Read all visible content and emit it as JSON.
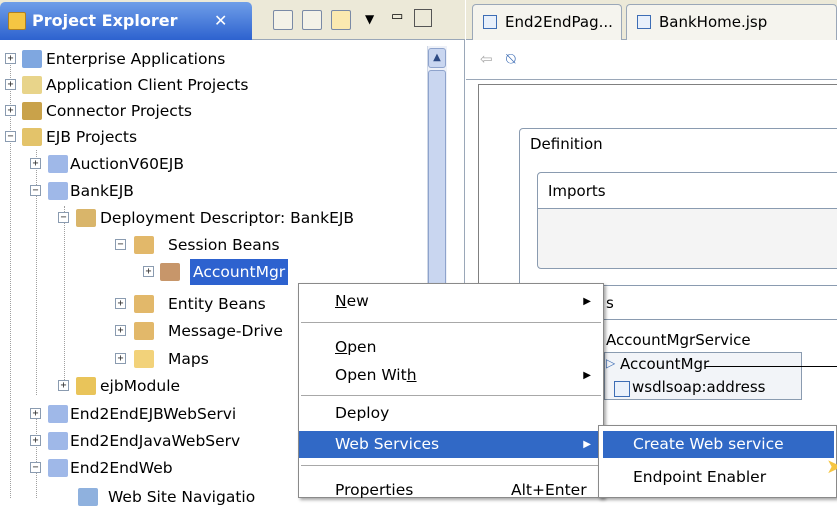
{
  "project_explorer": {
    "tab_title": "Project Explorer",
    "tab_close": "✕",
    "tree": [
      {
        "label": "Enterprise Applications"
      },
      {
        "label": "Application Client Projects"
      },
      {
        "label": "Connector Projects"
      },
      {
        "label": "EJB Projects"
      },
      {
        "label": "AuctionV60EJB"
      },
      {
        "label": "BankEJB"
      },
      {
        "label": "Deployment Descriptor: BankEJB"
      },
      {
        "label": "Session Beans"
      },
      {
        "label": "AccountMgr"
      },
      {
        "label": "Entity Beans"
      },
      {
        "label": "Message-Drive"
      },
      {
        "label": "Maps"
      },
      {
        "label": "ejbModule"
      },
      {
        "label": "End2EndEJBWebServi"
      },
      {
        "label": "End2EndJavaWebServ"
      },
      {
        "label": "End2EndWeb"
      },
      {
        "label": "Web Site Navigatio"
      }
    ]
  },
  "editor": {
    "tabs": [
      {
        "label": "End2EndPag..."
      },
      {
        "label": "BankHome.jsp"
      }
    ],
    "definition_title": "Definition",
    "imports_title": "Imports",
    "services_title": "s",
    "service_name": "AccountMgrService",
    "port_name": "AccountMgr",
    "address_label": "wsdlsoap:address"
  },
  "context_menu": {
    "items": [
      {
        "label": "New",
        "mnemonic": "N",
        "rest": "ew",
        "submenu": true
      },
      {
        "label": "Open",
        "mnemonic": "O",
        "rest": "pen"
      },
      {
        "label_pre": "Open Wit",
        "mnemonic": "h",
        "submenu": true
      },
      {
        "label": "Deploy"
      },
      {
        "label": "Web Services",
        "submenu": true
      },
      {
        "label": "Properties",
        "shortcut": "Alt+Enter"
      }
    ]
  },
  "web_services_submenu": {
    "items": [
      {
        "label": "Create Web service"
      },
      {
        "label": "Endpoint Enabler"
      }
    ]
  },
  "colors": {
    "selection": "#2d62cf",
    "menu_highlight": "#3169c6",
    "tab_active": "#4a7fdc"
  }
}
